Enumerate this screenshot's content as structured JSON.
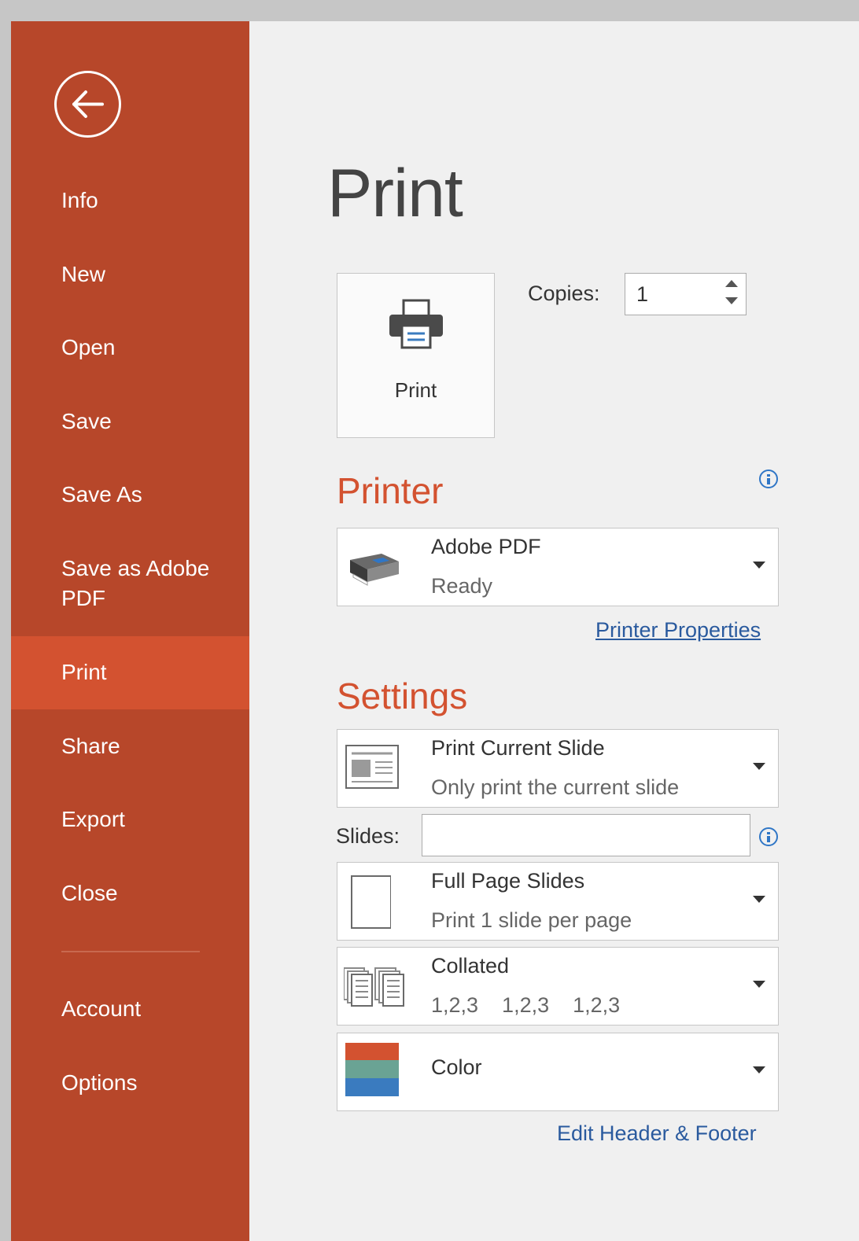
{
  "sidebar": {
    "back_label": "Back",
    "items": [
      {
        "label": "Info"
      },
      {
        "label": "New"
      },
      {
        "label": "Open"
      },
      {
        "label": "Save"
      },
      {
        "label": "Save As"
      },
      {
        "label": "Save as Adobe\nPDF"
      },
      {
        "label": "Print",
        "active": true
      },
      {
        "label": "Share"
      },
      {
        "label": "Export"
      },
      {
        "label": "Close"
      },
      {
        "label": "Account"
      },
      {
        "label": "Options"
      }
    ]
  },
  "main": {
    "title": "Print",
    "print_button_label": "Print",
    "copies": {
      "label": "Copies:",
      "value": "1"
    }
  },
  "printer": {
    "heading": "Printer",
    "name": "Adobe PDF",
    "status": "Ready",
    "properties_link": "Printer Properties"
  },
  "settings": {
    "heading": "Settings",
    "range": {
      "main": "Print Current Slide",
      "sub": "Only print the current slide"
    },
    "slides_label": "Slides:",
    "slides_value": "",
    "layout": {
      "main": "Full Page Slides",
      "sub": "Print 1 slide per page"
    },
    "collation": {
      "main": "Collated",
      "sub": "1,2,3    1,2,3    1,2,3"
    },
    "color": {
      "main": "Color"
    },
    "edit_header_footer_link": "Edit Header & Footer"
  },
  "colors": {
    "sidebar_bg": "#b7472a",
    "sidebar_active": "#d35230",
    "heading_accent": "#d35230",
    "link": "#2a5a9e",
    "color_swatch": [
      "#d35230",
      "#6aa394",
      "#3a7bbf"
    ]
  },
  "icons": {
    "back": "back-arrow-icon",
    "print": "printer-icon",
    "info": "info-icon",
    "printer_device": "printer-device-icon",
    "range": "slide-layout-icon",
    "layout": "full-page-icon",
    "collation": "collated-icon",
    "color": "color-swatch-icon",
    "dropdown": "chevron-down-icon"
  }
}
